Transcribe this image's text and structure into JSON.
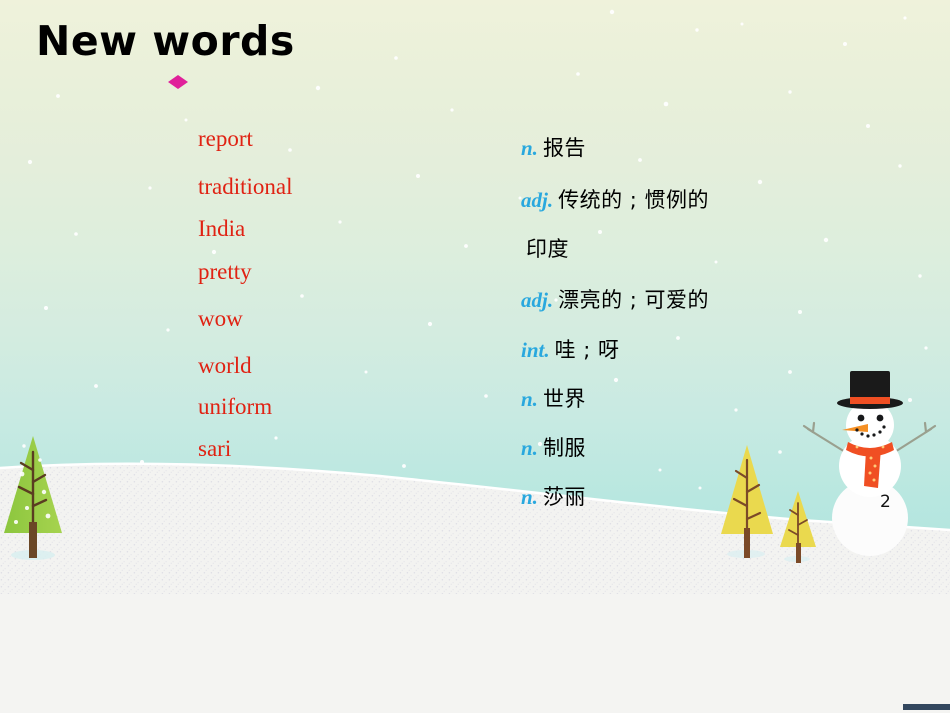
{
  "slide": {
    "title": "New words",
    "page_number": "2",
    "bullet_icon": "diamond-bullet",
    "colors": {
      "title": "#000000",
      "english_word": "#e02213",
      "part_of_speech": "#29a8de",
      "chinese": "#000000",
      "bullet": "#e0219a",
      "sky_top": "#eff2db",
      "sky_bottom": "#aee4dd",
      "snow": "#f2f2f2"
    },
    "vocabulary": [
      {
        "english": "report",
        "pos": "n.",
        "chinese": "报告"
      },
      {
        "english": "traditional",
        "pos": "adj.",
        "chinese": "传统的 ; 惯例的"
      },
      {
        "english": "India",
        "pos": "",
        "chinese": "印度"
      },
      {
        "english": "pretty",
        "pos": "adj.",
        "chinese": "漂亮的 ; 可爱的"
      },
      {
        "english": "wow",
        "pos": "int.",
        "chinese": "哇 ; 呀"
      },
      {
        "english": "world",
        "pos": "n.",
        "chinese": "世界"
      },
      {
        "english": "uniform",
        "pos": "n.",
        "chinese": "制服"
      },
      {
        "english": "sari",
        "pos": "n.",
        "chinese": "莎丽"
      }
    ],
    "illustrations": [
      {
        "name": "green-pine-tree",
        "position": "bottom-left"
      },
      {
        "name": "yellow-pine-tree-large",
        "position": "bottom-right"
      },
      {
        "name": "yellow-pine-tree-small",
        "position": "bottom-right"
      },
      {
        "name": "snowman",
        "position": "bottom-right"
      },
      {
        "name": "snow-hill",
        "position": "bottom"
      }
    ]
  }
}
